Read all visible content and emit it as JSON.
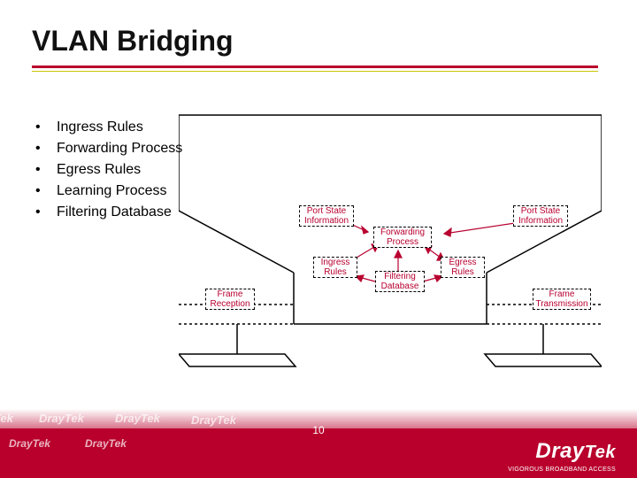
{
  "title": "VLAN Bridging",
  "bullets": [
    "Ingress Rules",
    "Forwarding Process",
    "Egress Rules",
    "Learning Process",
    "Filtering Database"
  ],
  "diagram": {
    "boxes": {
      "port_state_left": "Port State\nInformation",
      "port_state_right": "Port State\nInformation",
      "forwarding_process": "Forwarding\nProcess",
      "ingress_rules": "Ingress\nRules",
      "filtering_database": "Filtering\nDatabase",
      "egress_rules": "Egress\nRules",
      "frame_reception": "Frame\nReception",
      "frame_transmission": "Frame\nTransmission"
    }
  },
  "footer": {
    "page_number": "10",
    "brand_ghost": "DrayTek",
    "brand_main_a": "Dray",
    "brand_main_b": "Tek",
    "tagline": "VIGOROUS BROADBAND ACCESS"
  },
  "colors": {
    "brand": "#b9002c",
    "accent": "#c8c400",
    "label": "#b80030"
  }
}
